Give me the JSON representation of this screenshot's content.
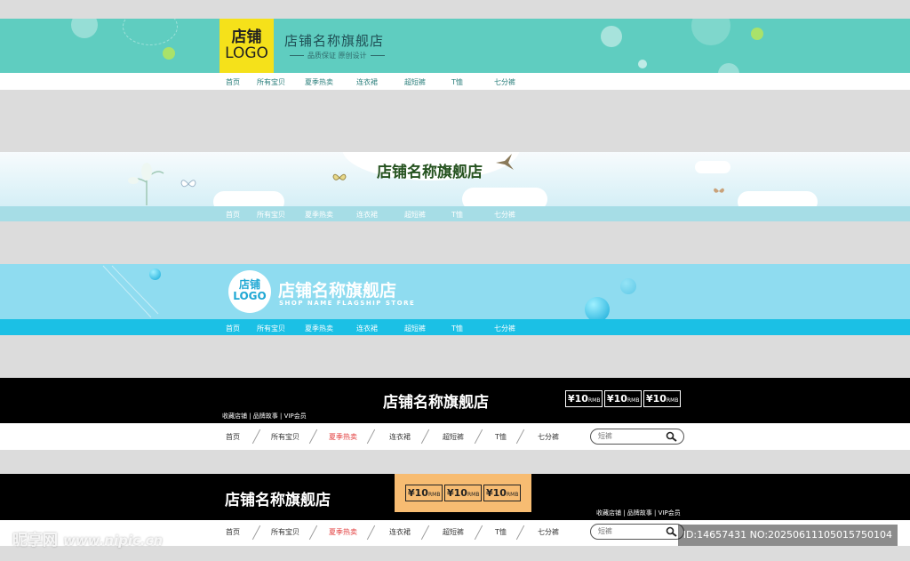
{
  "banner1": {
    "logo_line1": "店铺",
    "logo_line2": "LOGO",
    "title": "店铺名称旗舰店",
    "subtitle": "品质保证 原创设计"
  },
  "banner2": {
    "title": "店铺名称旗舰店"
  },
  "banner3": {
    "logo_line1": "店铺",
    "logo_line2": "LOGO",
    "title": "店铺名称旗舰店",
    "subtitle": "SHOP NAME FLAGSHIP STORE"
  },
  "banner4": {
    "title": "店铺名称旗舰店",
    "links": "收藏店铺 | 品牌故事 | VIP会员",
    "coupons": [
      {
        "amount": "¥10",
        "unit": "RMB"
      },
      {
        "amount": "¥10",
        "unit": "RMB"
      },
      {
        "amount": "¥10",
        "unit": "RMB"
      }
    ]
  },
  "banner5": {
    "title": "店铺名称旗舰店",
    "links": "收藏店铺 | 品牌故事 | VIP会员",
    "coupons": [
      {
        "amount": "¥10",
        "unit": "RMB"
      },
      {
        "amount": "¥10",
        "unit": "RMB"
      },
      {
        "amount": "¥10",
        "unit": "RMB"
      }
    ]
  },
  "nav": {
    "items": [
      "首页",
      "所有宝贝",
      "夏季热卖",
      "连衣裙",
      "超短裤",
      "T恤",
      "七分裤"
    ],
    "highlight_color": "#e23b3b"
  },
  "search": {
    "placeholder": "短裤"
  },
  "watermark": {
    "site": "昵享网",
    "url": "www.nipic.cn",
    "id": "ID:14657431 NO:20250611105015750104"
  },
  "colors": {
    "teal": "#5fcdc0",
    "logo_yellow": "#f5e11a",
    "sky_blue": "#8fdcf0",
    "nav_blue": "#1bc0e5",
    "coupon_orange": "#f7bc72"
  }
}
